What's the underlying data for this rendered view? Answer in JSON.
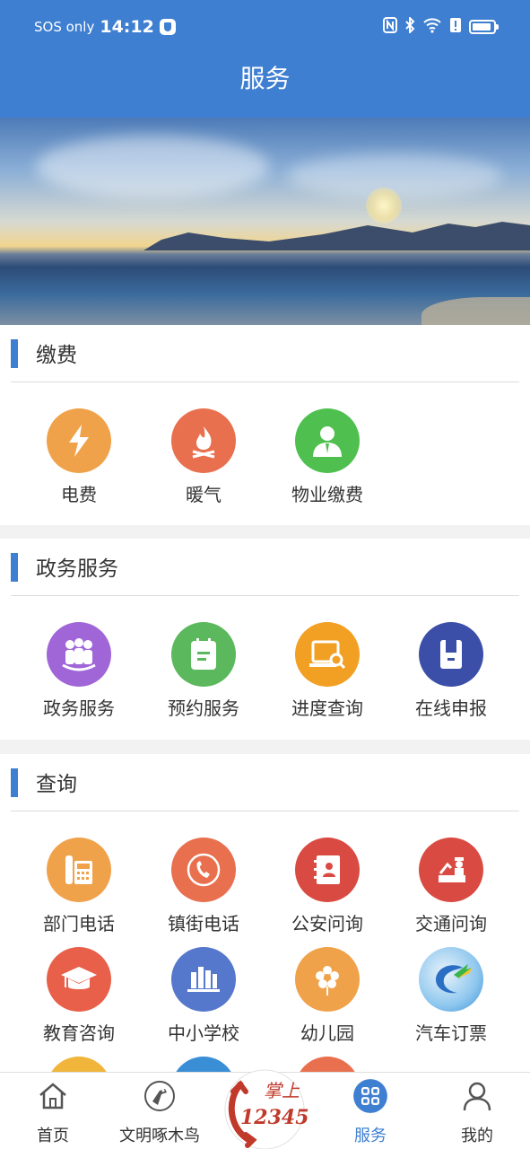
{
  "status_bar": {
    "carrier": "SOS only",
    "time": "14:12",
    "icons": [
      "nfc-icon",
      "bluetooth-icon",
      "wifi-icon",
      "alert-icon",
      "battery-icon"
    ]
  },
  "header": {
    "title": "服务"
  },
  "banner": {
    "description_icon": "seaside-sunset-banner"
  },
  "sections": [
    {
      "title": "缴费",
      "items": [
        {
          "label": "电费",
          "icon": "lightning-icon",
          "color": "#f0a24a"
        },
        {
          "label": "暖气",
          "icon": "flame-icon",
          "color": "#e8704e"
        },
        {
          "label": "物业缴费",
          "icon": "person-icon",
          "color": "#4fc04f"
        }
      ]
    },
    {
      "title": "政务服务",
      "items": [
        {
          "label": "政务服务",
          "icon": "people-group-icon",
          "color": "#a066d8"
        },
        {
          "label": "预约服务",
          "icon": "notebook-icon",
          "color": "#5cb85c"
        },
        {
          "label": "进度查询",
          "icon": "laptop-search-icon",
          "color": "#f2a024"
        },
        {
          "label": "在线申报",
          "icon": "folder-icon",
          "color": "#3b4fa8"
        }
      ]
    },
    {
      "title": "查询",
      "items": [
        {
          "label": "部门电话",
          "icon": "desk-phone-icon",
          "color": "#f0a24a"
        },
        {
          "label": "镇街电话",
          "icon": "phone-handset-icon",
          "color": "#e8704e"
        },
        {
          "label": "公安问询",
          "icon": "contact-book-icon",
          "color": "#d94b42"
        },
        {
          "label": "交通问询",
          "icon": "traffic-police-icon",
          "color": "#d94b42"
        },
        {
          "label": "教育咨询",
          "icon": "graduation-cap-icon",
          "color": "#e8604a"
        },
        {
          "label": "中小学校",
          "icon": "books-icon",
          "color": "#5577cc"
        },
        {
          "label": "幼儿园",
          "icon": "flower-icon",
          "color": "#f0a24a"
        },
        {
          "label": "汽车订票",
          "icon": "bus-ticket-logo-icon",
          "color": "#3a8ed6"
        }
      ]
    }
  ],
  "tabbar": {
    "tabs": [
      {
        "label": "首页",
        "icon": "home-icon"
      },
      {
        "label": "文明啄木鸟",
        "icon": "woodpecker-icon"
      },
      {
        "label": "",
        "icon": "hotline-12345-logo-icon"
      },
      {
        "label": "服务",
        "icon": "grid-icon"
      },
      {
        "label": "我的",
        "icon": "user-icon"
      }
    ],
    "active_index": 3,
    "center_logo_text": {
      "top": "掌上",
      "bottom": "12345"
    }
  }
}
